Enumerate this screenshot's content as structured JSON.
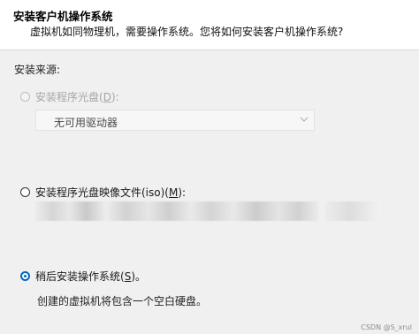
{
  "header": {
    "title": "安装客户机操作系统",
    "description": "虚拟机如同物理机，需要操作系统。您将如何安装客户机操作系统?"
  },
  "install_source": {
    "label": "安装来源:",
    "options": [
      {
        "label_prefix": "安装程序光盘(",
        "mnemonic": "D",
        "label_suffix": "):",
        "state": "disabled"
      },
      {
        "label_prefix": "安装程序光盘映像文件(iso)(",
        "mnemonic": "M",
        "label_suffix": "):",
        "state": "unselected"
      },
      {
        "label_prefix": "稍后安装操作系统(",
        "mnemonic": "S",
        "label_suffix": ")。",
        "state": "selected"
      }
    ],
    "drive_select": {
      "value": "无可用驱动器"
    },
    "later_description": "创建的虚拟机将包含一个空白硬盘。"
  },
  "colors": {
    "accent": "#0067c0",
    "disabled_text": "#a6a6a6"
  },
  "watermark": "CSDN @S_xrul"
}
